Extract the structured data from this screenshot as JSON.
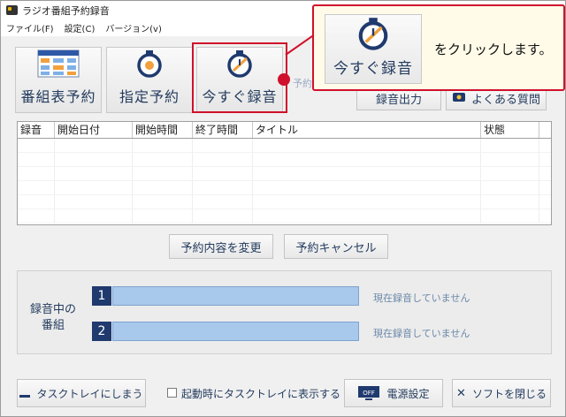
{
  "window": {
    "title": "ラジオ番組予約録音"
  },
  "menu": [
    "ファイル(F)",
    "設定(C)",
    "バージョン(v)"
  ],
  "toolbar": {
    "schedule_label": "番組表予約",
    "manual_label": "指定予約",
    "record_now_label": "今すぐ録音",
    "faded_label": "予約",
    "export_label": "録音出力",
    "faq_label": "よくある質問"
  },
  "callout": {
    "button_label": "今すぐ録音",
    "instruction": "をクリックします。"
  },
  "table": {
    "columns": [
      "録音",
      "開始日付",
      "開始時間",
      "終了時間",
      "タイトル",
      "状態"
    ],
    "rows": []
  },
  "actions": {
    "edit_label": "予約内容を変更",
    "cancel_label": "予約キャンセル"
  },
  "recording_group": {
    "label_line1": "録音中の",
    "label_line2": "番組",
    "slots": [
      {
        "number": "1",
        "status": "現在録音していません"
      },
      {
        "number": "2",
        "status": "現在録音していません"
      }
    ]
  },
  "footer": {
    "tray_label": "タスクトレイにしまう",
    "startup_label": "起動時にタスクトレイに表示する",
    "power_label": "電源設定",
    "power_icon_text": "OFF",
    "close_label": "ソフトを閉じる"
  },
  "colors": {
    "accent": "#d0112b",
    "navy": "#1f3a6e",
    "bar": "#a8c8ec",
    "callout_bg": "#fffbe8"
  }
}
